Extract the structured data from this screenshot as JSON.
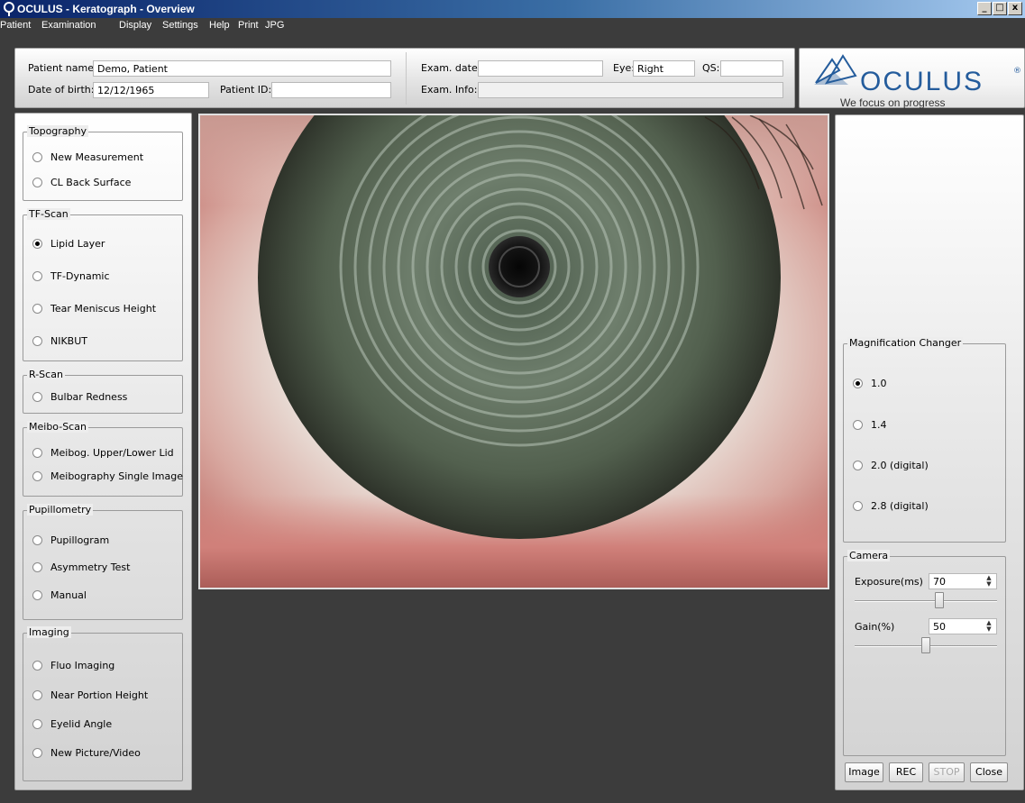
{
  "window": {
    "title": "OCULUS - Keratograph - Overview",
    "controls": {
      "minimize": "_",
      "maximize": "□",
      "close": "x"
    }
  },
  "menu": [
    "Patient",
    "Examination",
    "Display",
    "Settings",
    "Help",
    "Print",
    "JPG"
  ],
  "patient": {
    "name_label": "Patient name:",
    "name_value": "Demo, Patient",
    "dob_label": "Date of birth:",
    "dob_value": "12/12/1965",
    "id_label": "Patient ID:",
    "id_value": ""
  },
  "exam": {
    "date_label": "Exam. date:",
    "date_value": "",
    "eye_label": "Eye:",
    "eye_value": "Right",
    "qs_label": "QS:",
    "qs_value": "",
    "info_label": "Exam. Info:",
    "info_value": ""
  },
  "logo": {
    "brand": "OCULUS",
    "registered": "®",
    "slogan": "We focus on progress",
    "color": "#245c9c"
  },
  "groups": [
    {
      "title": "Topography",
      "items": [
        {
          "label": "New Measurement",
          "selected": false
        },
        {
          "label": "CL Back Surface",
          "selected": false
        }
      ]
    },
    {
      "title": "TF-Scan",
      "items": [
        {
          "label": "Lipid Layer",
          "selected": true
        },
        {
          "label": "TF-Dynamic",
          "selected": false
        },
        {
          "label": "Tear Meniscus Height",
          "selected": false
        },
        {
          "label": "NIKBUT",
          "selected": false
        }
      ]
    },
    {
      "title": "R-Scan",
      "items": [
        {
          "label": "Bulbar Redness",
          "selected": false
        }
      ]
    },
    {
      "title": "Meibo-Scan",
      "items": [
        {
          "label": "Meibog. Upper/Lower Lid",
          "selected": false
        },
        {
          "label": "Meibography Single Image",
          "selected": false
        }
      ]
    },
    {
      "title": "Pupillometry",
      "items": [
        {
          "label": "Pupillogram",
          "selected": false
        },
        {
          "label": "Asymmetry Test",
          "selected": false
        },
        {
          "label": "Manual",
          "selected": false
        }
      ]
    },
    {
      "title": "Imaging",
      "items": [
        {
          "label": "Fluo Imaging",
          "selected": false
        },
        {
          "label": "Near Portion Height",
          "selected": false
        },
        {
          "label": "Eyelid Angle",
          "selected": false
        },
        {
          "label": "New Picture/Video",
          "selected": false
        }
      ]
    }
  ],
  "magnification": {
    "title": "Magnification Changer",
    "items": [
      {
        "label": "1.0",
        "selected": true
      },
      {
        "label": "1.4",
        "selected": false
      },
      {
        "label": "2.0 (digital)",
        "selected": false
      },
      {
        "label": "2.8 (digital)",
        "selected": false
      }
    ]
  },
  "camera": {
    "title": "Camera",
    "exposure_label": "Exposure(ms)",
    "exposure_value": "70",
    "exposure_fraction": 0.6,
    "gain_label": "Gain(%)",
    "gain_value": "50",
    "gain_fraction": 0.5
  },
  "buttons": {
    "image": "Image",
    "rec": "REC",
    "stop": "STOP",
    "close": "Close"
  },
  "icons": {
    "app": "oculus-eye-icon"
  }
}
